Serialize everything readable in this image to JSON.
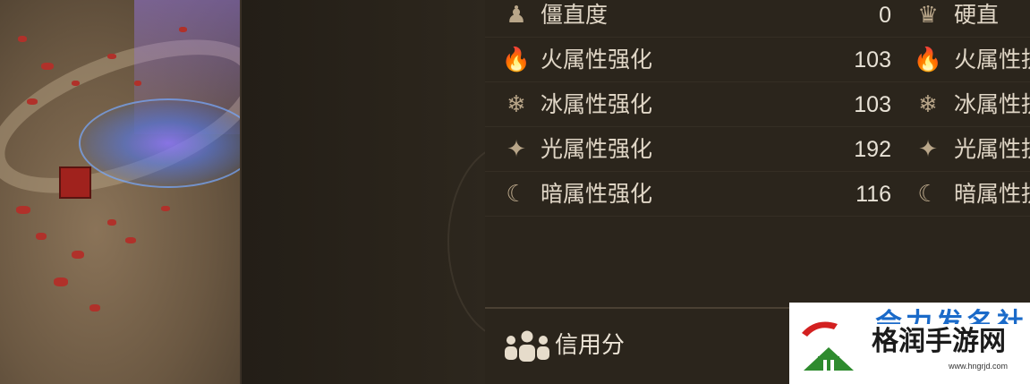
{
  "stats": [
    {
      "icon": "stagger-resist-icon",
      "glyph": "♟",
      "label": "僵直度",
      "value": "0",
      "right_icon": "hardstun-icon",
      "right_glyph": "♛",
      "right_label": "硬直"
    },
    {
      "icon": "fire-enhance-icon",
      "glyph": "🔥",
      "label": "火属性强化",
      "value": "103",
      "right_icon": "fire-resist-icon",
      "right_glyph": "🔥",
      "right_label": "火属性抗"
    },
    {
      "icon": "ice-enhance-icon",
      "glyph": "❄",
      "label": "冰属性强化",
      "value": "103",
      "right_icon": "ice-resist-icon",
      "right_glyph": "❄",
      "right_label": "冰属性抗"
    },
    {
      "icon": "light-enhance-icon",
      "glyph": "✦",
      "label": "光属性强化",
      "value": "192",
      "right_icon": "light-resist-icon",
      "right_glyph": "✦",
      "right_label": "光属性抗"
    },
    {
      "icon": "dark-enhance-icon",
      "glyph": "☾",
      "label": "暗属性强化",
      "value": "116",
      "right_icon": "dark-resist-icon",
      "right_glyph": "☾",
      "right_label": "暗属性抗"
    }
  ],
  "credit": {
    "label": "信用分"
  },
  "watermark": {
    "brand": "格润手游网",
    "url": "www.hngrjd.com",
    "partial_top": "会力发名社"
  },
  "colors": {
    "panel_bg": "#2b251c",
    "text": "#e0d6c6",
    "icon": "#b9a689"
  }
}
